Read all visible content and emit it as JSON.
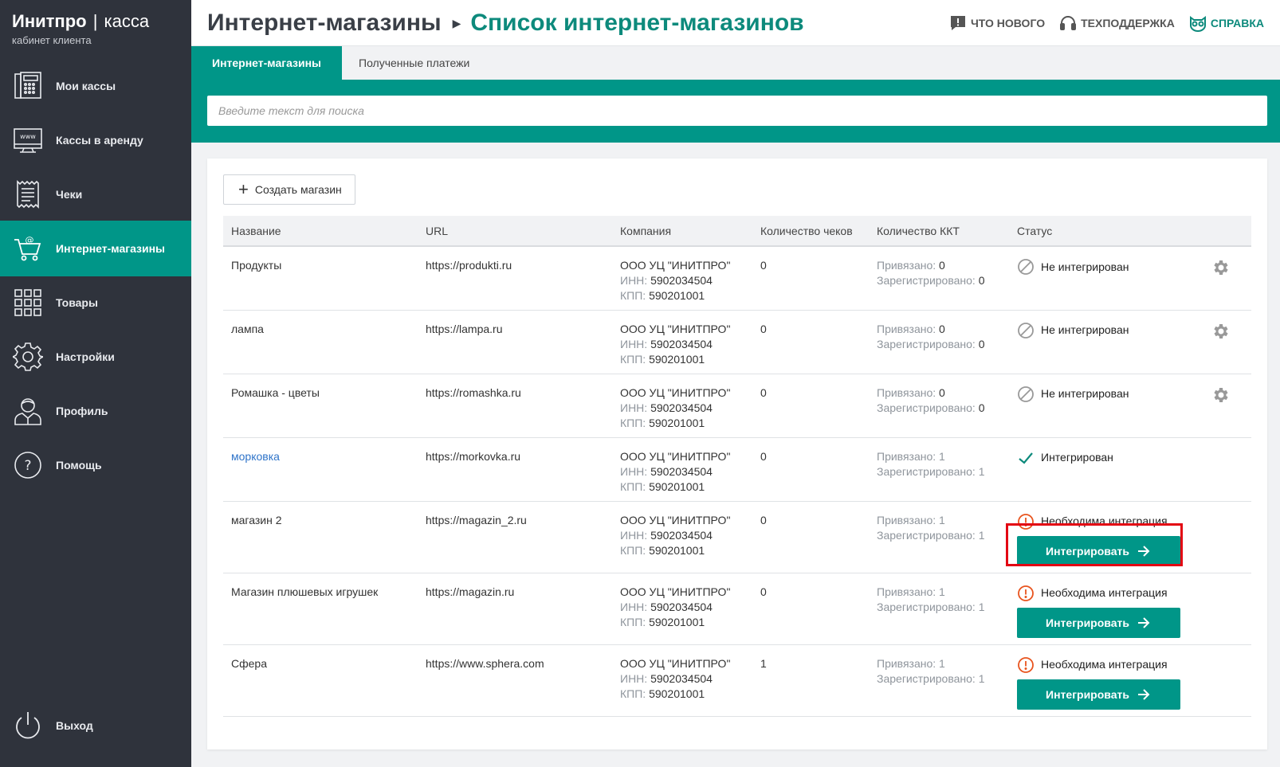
{
  "brand": {
    "name": "Инитпро",
    "sep": "|",
    "product": "касса",
    "subtitle": "кабинет клиента"
  },
  "nav": [
    {
      "label": "Мои кассы",
      "icon": "cash-register-icon"
    },
    {
      "label": "Кассы в аренду",
      "icon": "www-monitor-icon"
    },
    {
      "label": "Чеки",
      "icon": "receipt-icon"
    },
    {
      "label": "Интернет-магазины",
      "icon": "shopping-cart-icon",
      "active": true
    },
    {
      "label": "Товары",
      "icon": "grid-icon"
    },
    {
      "label": "Настройки",
      "icon": "gear-icon"
    },
    {
      "label": "Профиль",
      "icon": "user-icon"
    },
    {
      "label": "Помощь",
      "icon": "question-icon"
    }
  ],
  "logout": {
    "label": "Выход",
    "icon": "power-icon"
  },
  "header": {
    "crumb1": "Интернет-магазины",
    "crumb2": "Список интернет-магазинов",
    "links": {
      "whats_new": "ЧТО НОВОГО",
      "support": "ТЕХПОДДЕРЖКА",
      "help": "СПРАВКА"
    }
  },
  "tabs": {
    "stores": "Интернет-магазины",
    "payments": "Полученные платежи"
  },
  "search": {
    "placeholder": "Введите текст для поиска"
  },
  "create_button": "Создать магазин",
  "columns": {
    "name": "Название",
    "url": "URL",
    "company": "Компания",
    "checks": "Количество чеков",
    "kkt": "Количество ККТ",
    "status": "Статус"
  },
  "labels": {
    "inn": "ИНН:",
    "kpp": "КПП:",
    "bound": "Привязано:",
    "registered": "Зарегистрировано:",
    "integrate": "Интегрировать"
  },
  "stores": [
    {
      "name": "Продукты",
      "url": "https://produkti.ru",
      "company": "ООО УЦ \"ИНИТПРО\"",
      "inn": "5902034504",
      "kpp": "590201001",
      "checks": "0",
      "bound": "0",
      "registered": "0",
      "status": "Не интегрирован"
    },
    {
      "name": "лампа",
      "url": "https://lampa.ru",
      "company": "ООО УЦ \"ИНИТПРО\"",
      "inn": "5902034504",
      "kpp": "590201001",
      "checks": "0",
      "bound": "0",
      "registered": "0",
      "status": "Не интегрирован"
    },
    {
      "name": "Ромашка - цветы",
      "url": "https://romashka.ru",
      "company": "ООО УЦ \"ИНИТПРО\"",
      "inn": "5902034504",
      "kpp": "590201001",
      "checks": "0",
      "bound": "0",
      "registered": "0",
      "status": "Не интегрирован"
    },
    {
      "name": "морковка",
      "url": "https://morkovka.ru",
      "company": "ООО УЦ \"ИНИТПРО\"",
      "inn": "5902034504",
      "kpp": "590201001",
      "checks": "0",
      "bound": "1",
      "registered": "1",
      "status": "Интегрирован"
    },
    {
      "name": "магазин 2",
      "url": "https://magazin_2.ru",
      "company": "ООО УЦ \"ИНИТПРО\"",
      "inn": "5902034504",
      "kpp": "590201001",
      "checks": "0",
      "bound": "1",
      "registered": "1",
      "status": "Необходима интеграция"
    },
    {
      "name": "Магазин плюшевых игрушек",
      "url": "https://magazin.ru",
      "company": "ООО УЦ \"ИНИТПРО\"",
      "inn": "5902034504",
      "kpp": "590201001",
      "checks": "0",
      "bound": "1",
      "registered": "1",
      "status": "Необходима интеграция"
    },
    {
      "name": "Сфера",
      "url": "https://www.sphera.com",
      "company": "ООО УЦ \"ИНИТПРО\"",
      "inn": "5902034504",
      "kpp": "590201001",
      "checks": "1",
      "bound": "1",
      "registered": "1",
      "status": "Необходима интеграция"
    }
  ],
  "colors": {
    "sidebar": "#2f333c",
    "accent": "#009688",
    "accent_text": "#0d8a7c",
    "warning": "#e8541e",
    "highlight": "#e30613",
    "link": "#2f74c9"
  }
}
